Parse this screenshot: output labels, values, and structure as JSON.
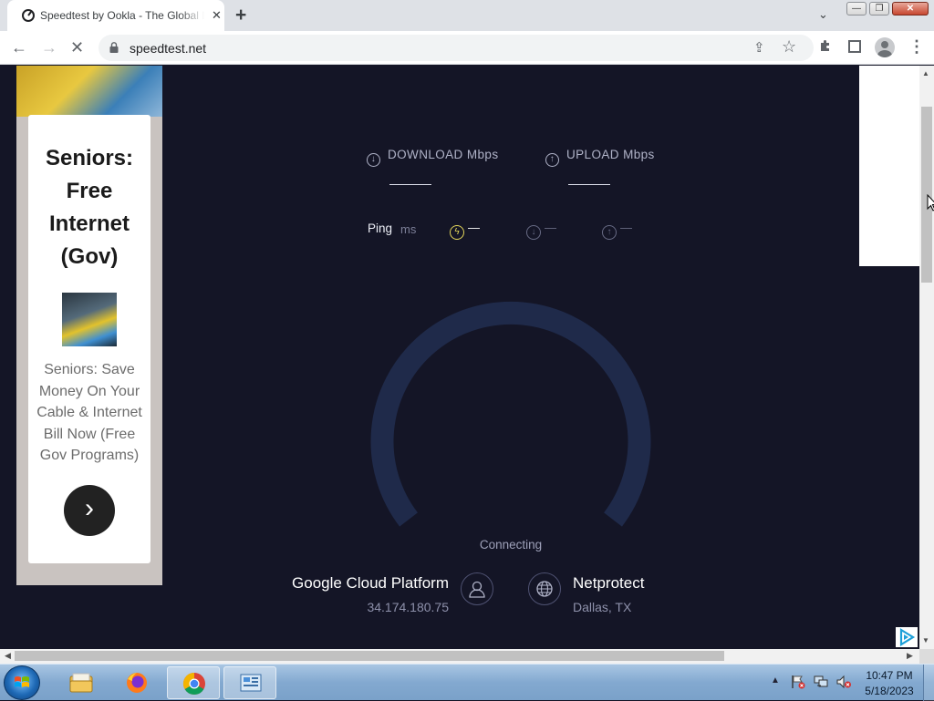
{
  "browser": {
    "tab_title": "Speedtest by Ookla - The Global Broadband Speed Test",
    "tab_close_glyph": "✕",
    "new_tab_glyph": "+",
    "tab_search_glyph": "⌄",
    "window_controls": {
      "minimize": "—",
      "maximize": "❐",
      "close": "✕"
    },
    "url": "speedtest.net",
    "icons": [
      "back-arrow-icon",
      "forward-arrow-icon",
      "stop-icon",
      "lock-icon",
      "share-icon",
      "star-icon",
      "extensions-icon",
      "side-panel-icon",
      "profile-icon",
      "menu-icon"
    ]
  },
  "ad": {
    "headline": "Seniors: Free Internet (Gov)",
    "body": "Seniors: Save Money On Your Cable & Internet Bill Now (Free Gov Programs)",
    "cta_glyph": "›"
  },
  "speedtest": {
    "download_label": "DOWNLOAD Mbps",
    "upload_label": "UPLOAD Mbps",
    "ping_label": "Ping",
    "ping_unit": "ms",
    "ping_idle_value": "—",
    "ping_download_value": "—",
    "ping_upload_value": "—",
    "status": "Connecting",
    "isp_name": "Google Cloud Platform",
    "isp_ip": "34.174.180.75",
    "server_name": "Netprotect",
    "server_location": "Dallas, TX"
  },
  "taskbar": {
    "time": "10:47 PM",
    "date": "5/18/2023",
    "apps": [
      "windows-explorer",
      "firefox",
      "google-chrome",
      "control-panel"
    ],
    "tray_chevron": "▲"
  },
  "colors": {
    "page_bg": "#141526",
    "gauge_track": "#1f2a4a",
    "jitter_accent": "#e4d65a"
  }
}
